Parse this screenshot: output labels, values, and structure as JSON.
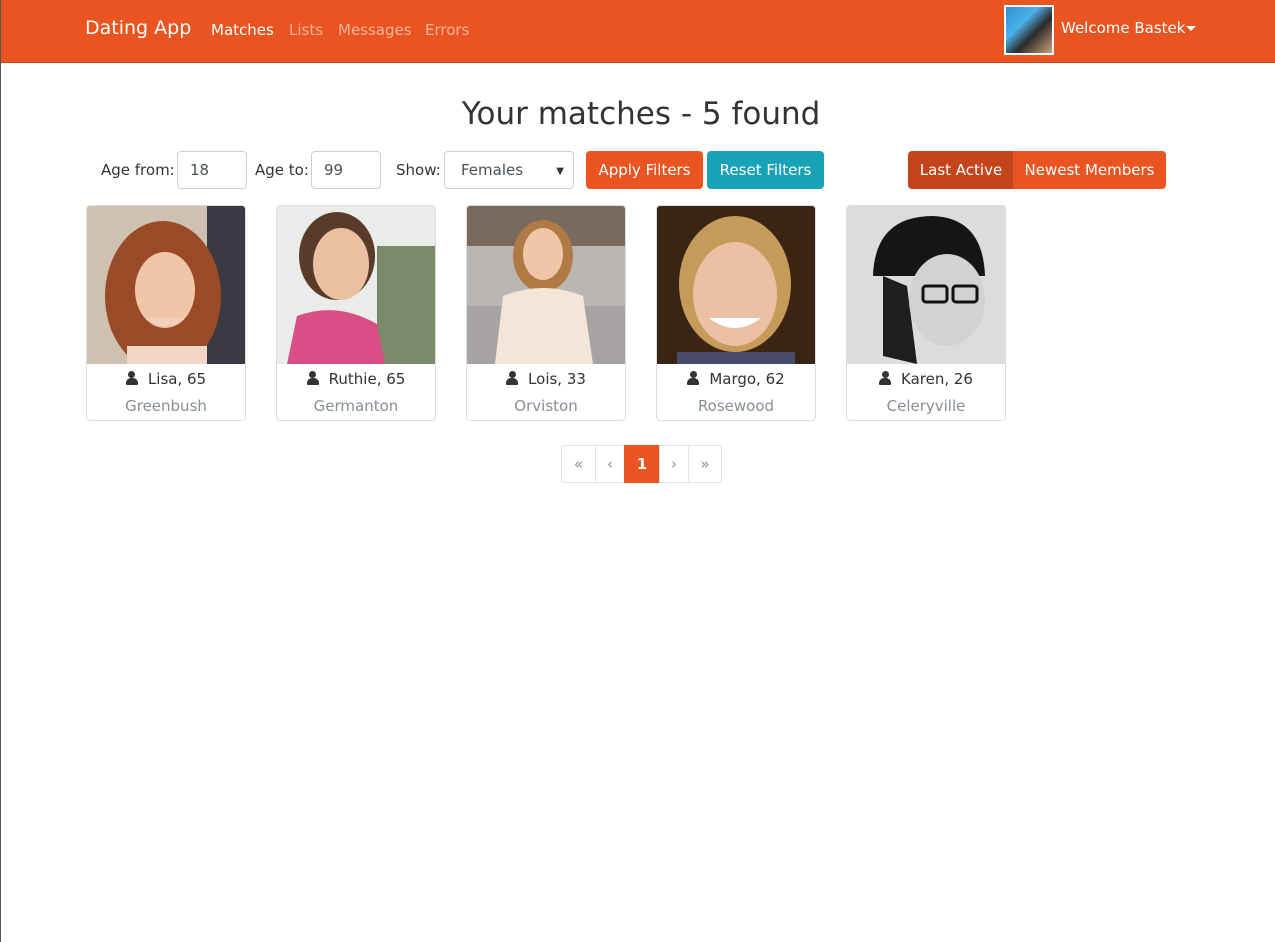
{
  "navbar": {
    "brand": "Dating App",
    "links": [
      "Matches",
      "Lists",
      "Messages",
      "Errors"
    ],
    "welcome": "Welcome Bastek"
  },
  "title": "Your matches - 5 found",
  "filters": {
    "age_from_label": "Age from:",
    "age_from_value": "18",
    "age_to_label": "Age to:",
    "age_to_value": "99",
    "show_label": "Show:",
    "show_value": "Females",
    "apply_label": "Apply Filters",
    "reset_label": "Reset Filters",
    "sort_last_active": "Last Active",
    "sort_newest": "Newest Members"
  },
  "members": [
    {
      "name": "Lisa, 65",
      "city": "Greenbush"
    },
    {
      "name": "Ruthie, 65",
      "city": "Germanton"
    },
    {
      "name": "Lois, 33",
      "city": "Orviston"
    },
    {
      "name": "Margo, 62",
      "city": "Rosewood"
    },
    {
      "name": "Karen, 26",
      "city": "Celeryville"
    }
  ],
  "pagination": {
    "first": "«",
    "prev": "‹",
    "current": "1",
    "next": "›",
    "last": "»"
  },
  "colors": {
    "brand": "#e95420",
    "brand_dark": "#c4451b",
    "teal": "#17a2b8",
    "muted": "#868e96"
  }
}
